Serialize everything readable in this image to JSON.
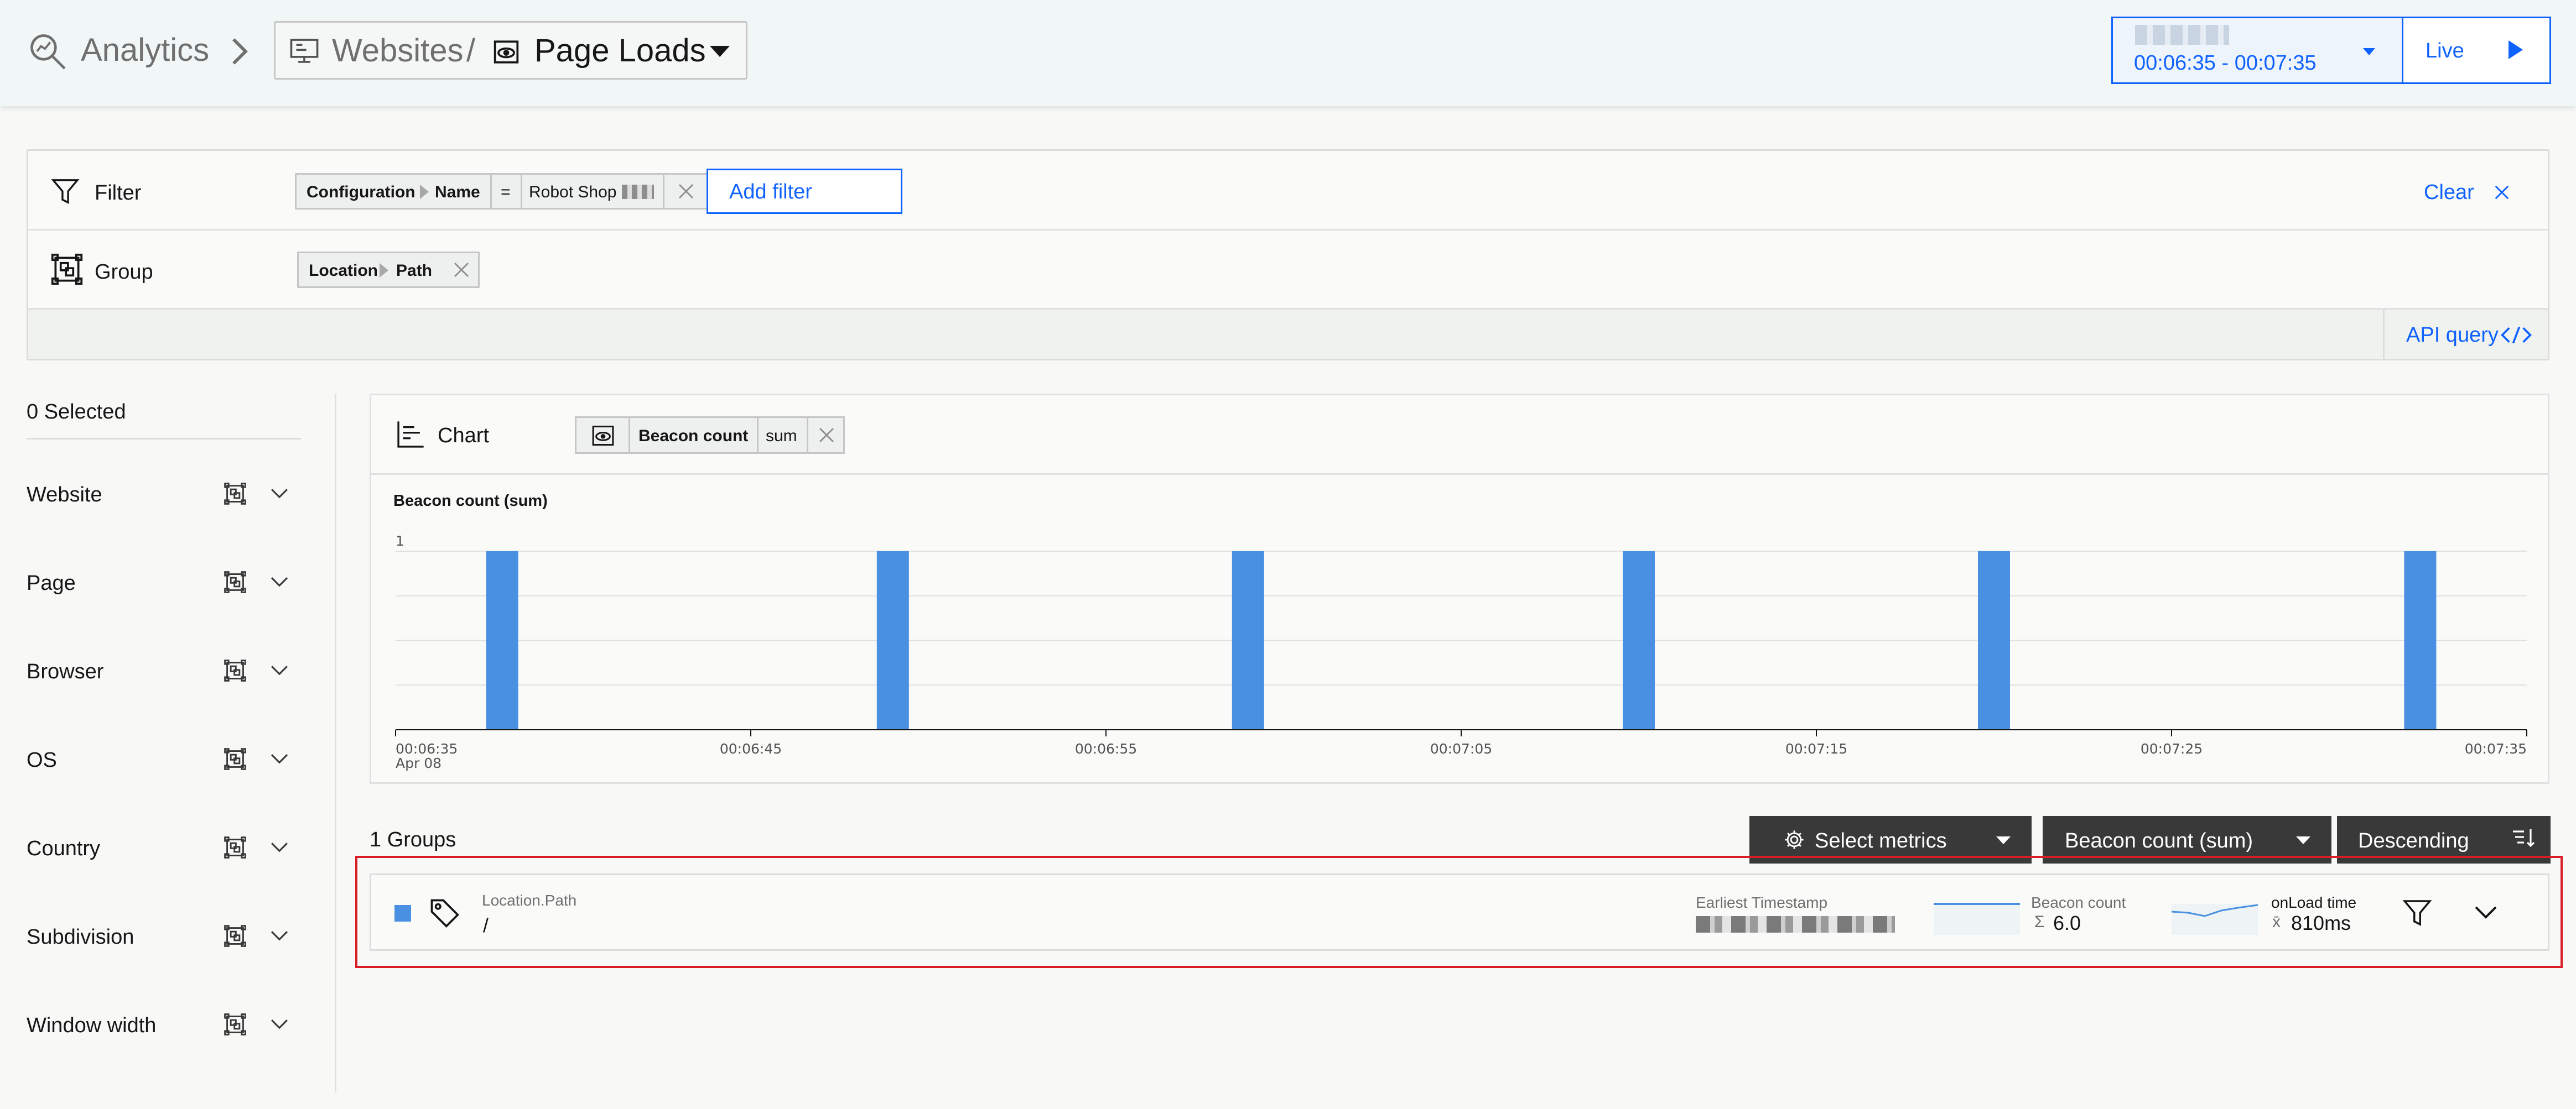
{
  "header": {
    "analytics_label": "Analytics",
    "websites_label": "Websites",
    "separator": "/",
    "page_loads_label": "Page Loads",
    "time_range": "00:06:35 - 00:07:35",
    "live_label": "Live"
  },
  "filter": {
    "label": "Filter",
    "tag": {
      "part1": "Configuration",
      "part2": "Name",
      "operator": "=",
      "value": "Robot Shop"
    },
    "add_filter_label": "Add filter",
    "clear_label": "Clear"
  },
  "group": {
    "label": "Group",
    "tag": {
      "part1": "Location",
      "part2": "Path"
    }
  },
  "api_query_label": "API query",
  "sidebar": {
    "selected_label": "0 Selected",
    "items": [
      {
        "label": "Website"
      },
      {
        "label": "Page"
      },
      {
        "label": "Browser"
      },
      {
        "label": "OS"
      },
      {
        "label": "Country"
      },
      {
        "label": "Subdivision"
      },
      {
        "label": "Window width"
      }
    ]
  },
  "chart_panel": {
    "label": "Chart",
    "metric_tag": {
      "name": "Beacon count",
      "aggregation": "sum"
    }
  },
  "chart_data": {
    "type": "bar",
    "title": "Beacon count (sum)",
    "ylabel": "",
    "xlabel": "",
    "ylim": [
      0,
      1
    ],
    "y_ticks": [
      "1"
    ],
    "x_ticks": [
      "00:06:35",
      "00:06:45",
      "00:06:55",
      "00:07:05",
      "00:07:15",
      "00:07:25",
      "00:07:35"
    ],
    "x_tick_date": "Apr 08",
    "x_range_seconds": [
      395,
      455
    ],
    "x": [
      "00:06:38",
      "00:06:49",
      "00:06:59",
      "00:07:10",
      "00:07:20",
      "00:07:32"
    ],
    "values": [
      1,
      1,
      1,
      1,
      1,
      1
    ],
    "color": "#4a90e2",
    "grid": true
  },
  "groups": {
    "count_label": "1 Groups",
    "select_metrics_label": "Select metrics",
    "sort_metric_label": "Beacon count (sum)",
    "sort_order_label": "Descending",
    "row": {
      "key_label": "Location.Path",
      "value": "/",
      "earliest_timestamp_label": "Earliest Timestamp",
      "beacon_count_label": "Beacon count",
      "beacon_count_prefix": "Σ",
      "beacon_count_value": "6.0",
      "onload_label": "onLoad time",
      "onload_prefix": "x̄",
      "onload_value": "810ms",
      "square_color": "#4a90e2"
    }
  }
}
